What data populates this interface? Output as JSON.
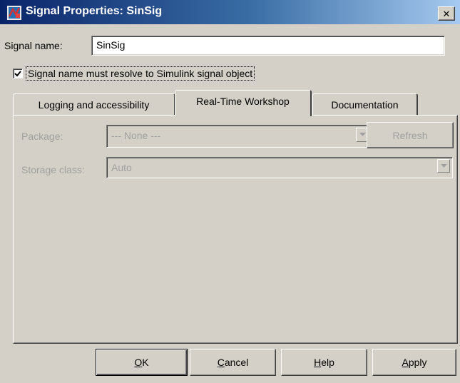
{
  "window": {
    "title": "Signal Properties: SinSig",
    "close_glyph": "✕"
  },
  "signal": {
    "name_label": "Signal name:",
    "name_value": "SinSig"
  },
  "resolve": {
    "checked": true,
    "label": "Signal name must resolve to Simulink signal object"
  },
  "tabs": [
    {
      "label": "Logging and accessibility",
      "active": false
    },
    {
      "label": "Real-Time Workshop",
      "active": true
    },
    {
      "label": "Documentation",
      "active": false
    }
  ],
  "rtw": {
    "package_label": "Package:",
    "package_value": "--- None ---",
    "refresh_label": "Refresh",
    "storage_label": "Storage class:",
    "storage_value": "Auto"
  },
  "buttons": {
    "ok": {
      "accel": "O",
      "rest": "K"
    },
    "cancel": {
      "accel": "C",
      "rest": "ancel"
    },
    "help": {
      "accel": "H",
      "rest": "elp"
    },
    "apply": {
      "accel": "A",
      "rest": "pply"
    }
  },
  "icons": {
    "app": "simulink-window-icon",
    "close": "close-icon",
    "check": "checkmark-icon",
    "dropdown": "chevron-down-icon"
  },
  "colors": {
    "dialog_bg": "#d4d0c8",
    "title_start": "#0a246a",
    "title_end": "#a6caf0",
    "disabled_text": "#a0a0a0"
  }
}
